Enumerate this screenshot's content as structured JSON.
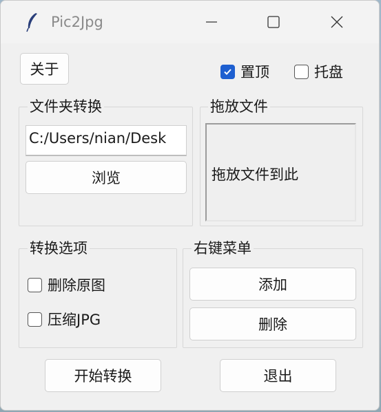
{
  "window": {
    "title": "Pic2Jpg"
  },
  "top": {
    "about_label": "关于",
    "topmost": {
      "label": "置顶",
      "checked": true
    },
    "tray": {
      "label": "托盘",
      "checked": false
    }
  },
  "folder_convert": {
    "legend": "文件夹转换",
    "path_value": "C:/Users/nian/Desk",
    "browse_label": "浏览"
  },
  "drag_drop": {
    "legend": "拖放文件",
    "hint": "拖放文件到此"
  },
  "convert_options": {
    "legend": "转换选项",
    "delete_original": {
      "label": "删除原图",
      "checked": false
    },
    "compress_jpg": {
      "label": "压缩JPG",
      "checked": false
    }
  },
  "context_menu": {
    "legend": "右键菜单",
    "add_label": "添加",
    "remove_label": "删除"
  },
  "bottom": {
    "start_label": "开始转换",
    "exit_label": "退出"
  }
}
